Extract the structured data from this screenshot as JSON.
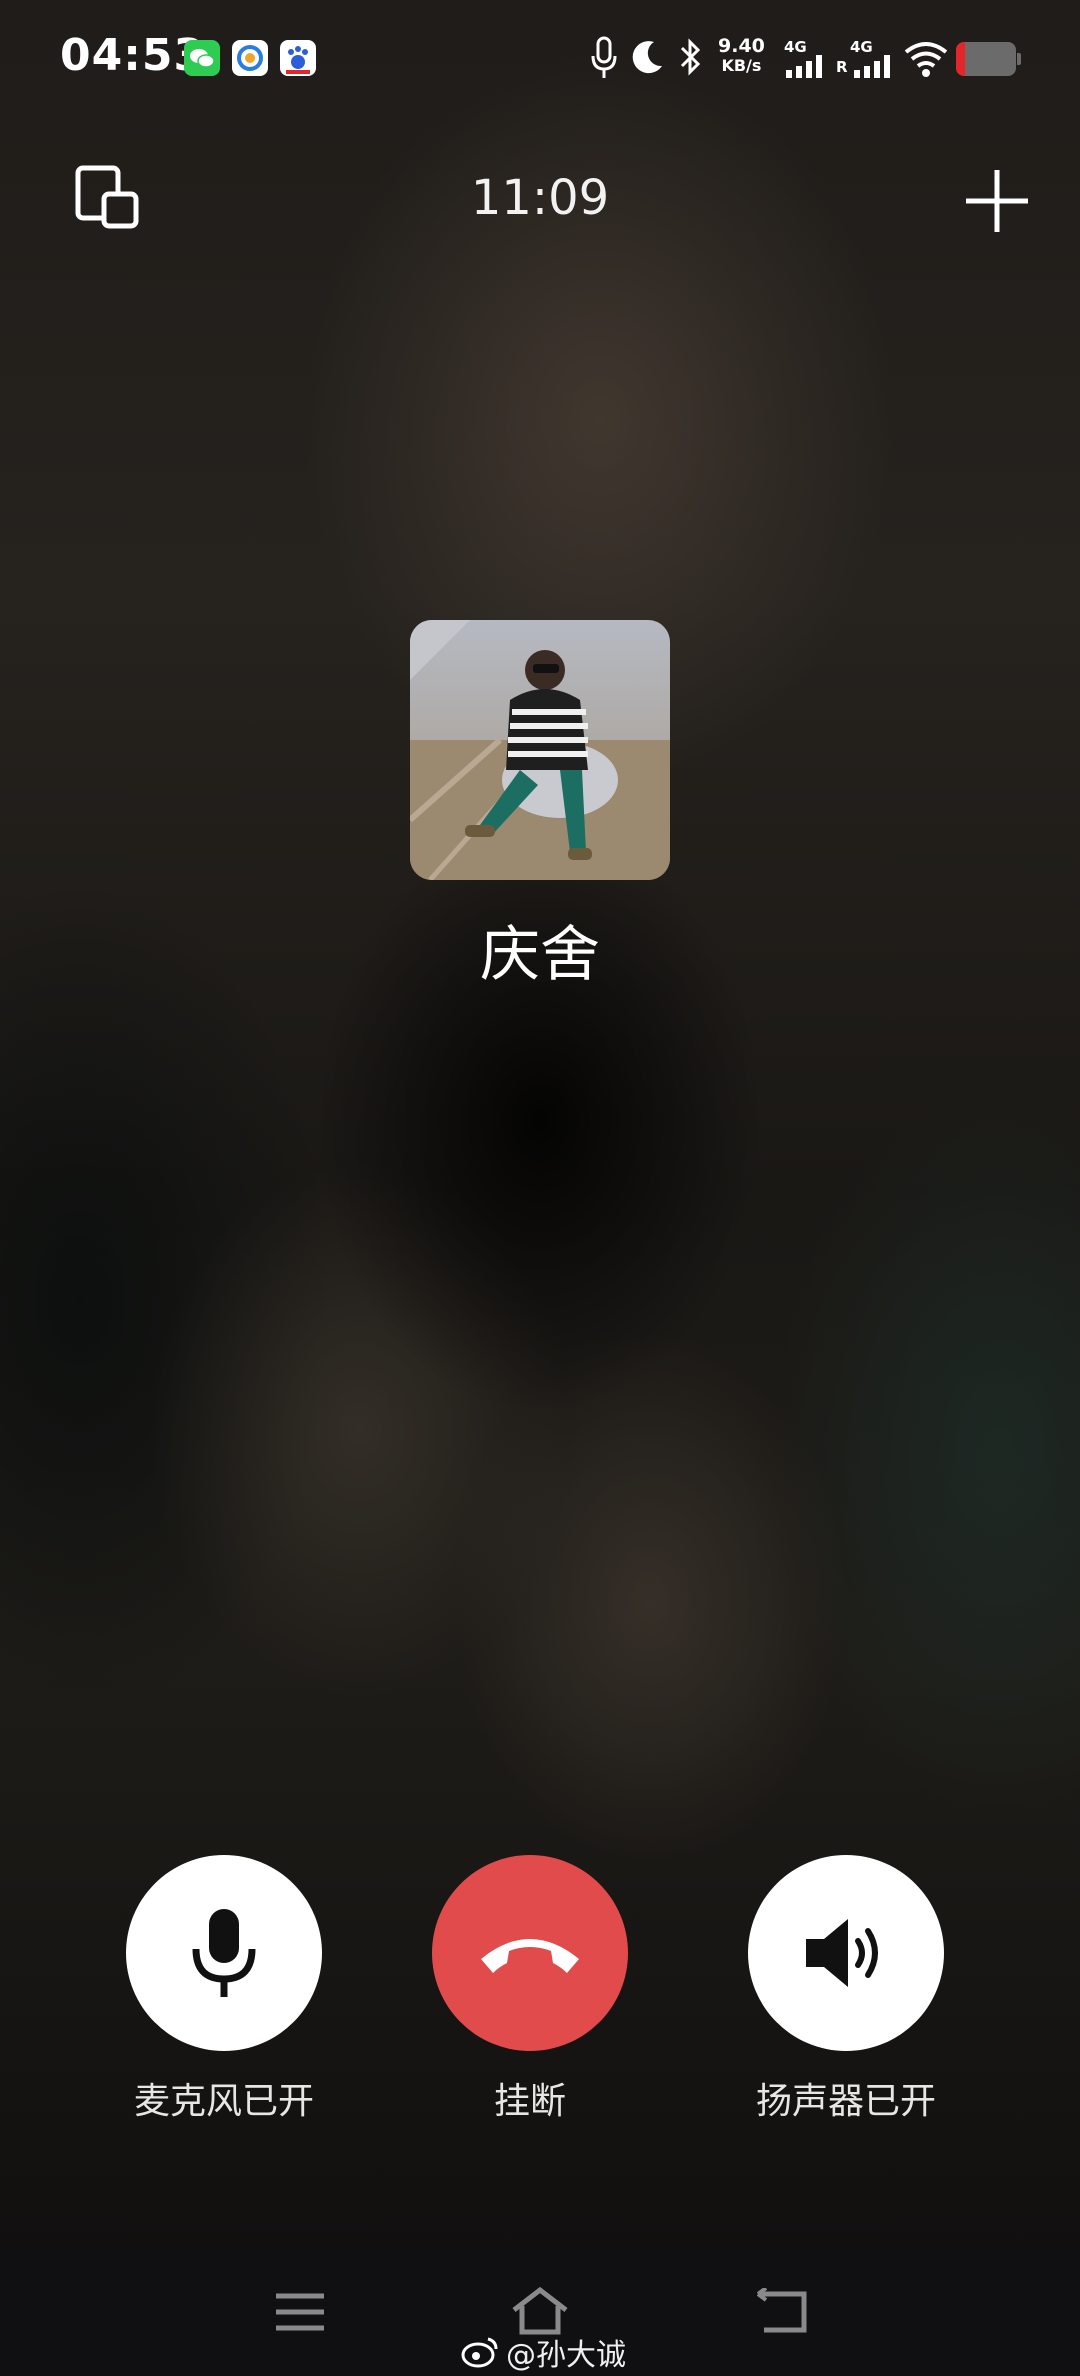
{
  "status_bar": {
    "time": "04:53",
    "net_speed_value": "9.40",
    "net_speed_unit": "KB/s",
    "sim1_label": "4G",
    "sim2_label": "4G",
    "sim2_roaming": "R",
    "battery_level": 0.15,
    "battery_color": "#e4262a",
    "app_icons": [
      "wechat-icon",
      "browser-icon",
      "baidu-icon"
    ]
  },
  "call": {
    "duration": "11:09",
    "contact_name": "庆舍"
  },
  "controls": {
    "mic_label": "麦克风已开",
    "hangup_label": "挂断",
    "speaker_label": "扬声器已开",
    "hangup_color": "#e14b4b"
  },
  "watermark": {
    "text": "@孙大诚"
  }
}
